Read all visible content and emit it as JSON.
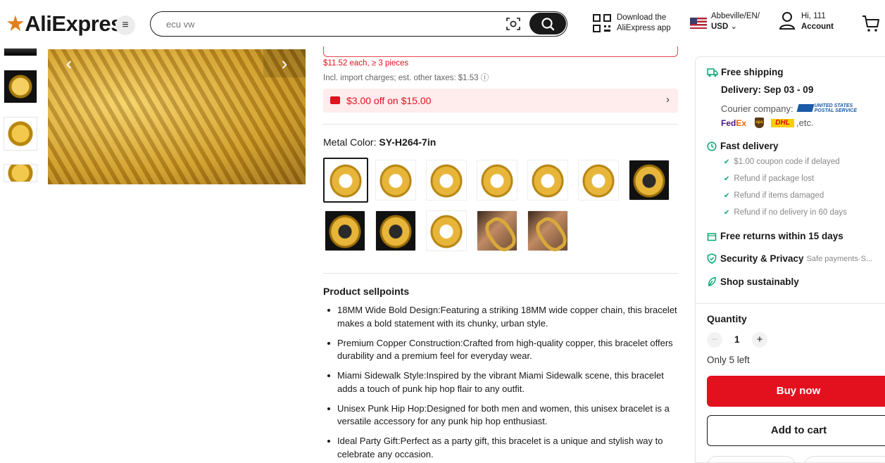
{
  "header": {
    "logo": "AliExpress",
    "search_placeholder": "ecu vw",
    "download_line1": "Download the",
    "download_line2": "AliExpress app",
    "location_line1": "Abbeville/EN/",
    "location_line2": "USD",
    "account_line1": "Hi, 111",
    "account_line2": "Account"
  },
  "price": {
    "tier_text": "$11.52 each, ≥ 3 pieces",
    "tax_text": "Incl. import charges; est. other taxes: $1.53 ⓘ",
    "coupon_text": "$3.00 off on $15.00"
  },
  "variant": {
    "label": "Metal Color: ",
    "selected": "SY-H264-7in"
  },
  "sellpoints": {
    "title": "Product sellpoints",
    "items": [
      "18MM Wide Bold Design:Featuring a striking 18MM wide copper chain, this bracelet makes a bold statement with its chunky, urban style.",
      "Premium Copper Construction:Crafted from high-quality copper, this bracelet offers durability and a premium feel for everyday wear.",
      "Miami Sidewalk Style:Inspired by the vibrant Miami Sidewalk scene, this bracelet adds a touch of punk hip hop flair to any outfit.",
      "Unisex Punk Hip Hop:Designed for both men and women, this unisex bracelet is a versatile accessory for any punk hip hop enthusiast.",
      "Ideal Party Gift:Perfect as a party gift, this bracelet is a unique and stylish way to celebrate any occasion."
    ]
  },
  "shipping": {
    "free_shipping": "Free shipping",
    "delivery": "Delivery: Sep 03 - 09",
    "courier_label": "Courier company:",
    "usps_line1": "UNITED STATES",
    "usps_line2": "POSTAL SERVICE",
    "fedex_1": "Fed",
    "fedex_2": "Ex",
    "ups": "ups",
    "dhl": "DHL",
    "etc": ",etc.",
    "fast_delivery": "Fast delivery",
    "guarantees": [
      "$1.00 coupon code if delayed",
      "Refund if package lost",
      "Refund if items damaged",
      "Refund if no delivery in 60 days"
    ],
    "free_returns": "Free returns within 15 days",
    "security": "Security & Privacy",
    "security_sub": "Safe payments·S...",
    "sustainably": "Shop sustainably"
  },
  "purchase": {
    "quantity_label": "Quantity",
    "quantity_value": "1",
    "minus": "−",
    "plus": "+",
    "stock": "Only 5 left",
    "buy_now": "Buy now",
    "add_to_cart": "Add to cart"
  },
  "colors": {
    "brand_red": "#e3101e",
    "success_green": "#00a96e"
  }
}
